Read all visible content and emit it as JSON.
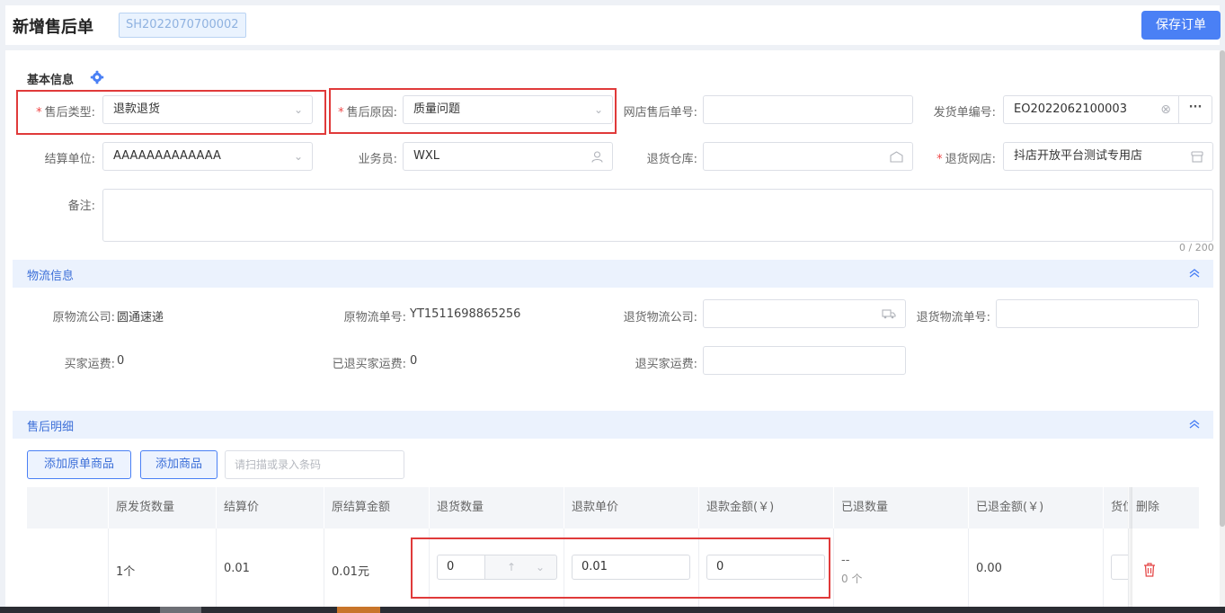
{
  "header": {
    "title": "新增售后单",
    "order_no": "SH2022070700002",
    "save_label": "保存订单"
  },
  "basic": {
    "title": "基本信息",
    "after_sale_type": {
      "label": "售后类型:",
      "value": "退款退货"
    },
    "after_sale_reason": {
      "label": "售后原因:",
      "value": "质量问题"
    },
    "shop_after_no": {
      "label": "网店售后单号:",
      "value": ""
    },
    "ship_no": {
      "label": "发货单编号:",
      "value": "EO2022062100003",
      "more": "···"
    },
    "settle_unit": {
      "label": "结算单位:",
      "value": "AAAAAAAAAAAAA"
    },
    "salesman": {
      "label": "业务员:",
      "value": "WXL"
    },
    "return_warehouse": {
      "label": "退货仓库:",
      "value": ""
    },
    "return_shop": {
      "label": "退货网店:",
      "value": "抖店开放平台测试专用店"
    },
    "remark": {
      "label": "备注:",
      "counter": "0 / 200"
    }
  },
  "logistics": {
    "title": "物流信息",
    "orig_company": {
      "label": "原物流公司:",
      "value": "圆通速递"
    },
    "orig_no": {
      "label": "原物流单号:",
      "value": "YT1511698865256"
    },
    "return_company": {
      "label": "退货物流公司:",
      "value": ""
    },
    "return_no": {
      "label": "退货物流单号:",
      "value": ""
    },
    "buyer_freight": {
      "label": "买家运费:",
      "value": "0"
    },
    "refunded_freight": {
      "label": "已退买家运费:",
      "value": "0"
    },
    "refund_freight": {
      "label": "退买家运费:",
      "value": ""
    }
  },
  "detail": {
    "title": "售后明细",
    "add_orig_label": "添加原单商品",
    "add_item_label": "添加商品",
    "scan_placeholder": "请扫描或录入条码",
    "columns": [
      "原发货数量",
      "结算价",
      "原结算金额",
      "退货数量",
      "退款单价",
      "退款金额(￥)",
      "已退数量",
      "已退金额(￥)",
      "货位",
      "删除"
    ],
    "row": {
      "orig_qty": "1个",
      "settle_price": "0.01",
      "orig_amount": "0.01元",
      "return_qty": "0",
      "refund_price": "0.01",
      "refund_amount": "0",
      "returned_qty_top": "--",
      "returned_qty_bottom": "0 个",
      "returned_amount": "0.00"
    }
  },
  "colors": {
    "primary": "#4a80f5",
    "highlight": "#e03a3a",
    "band": "#ebf2fd"
  }
}
